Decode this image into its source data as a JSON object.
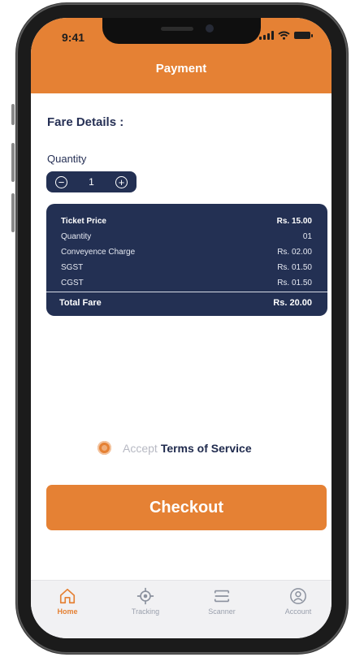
{
  "status_bar": {
    "time": "9:41"
  },
  "header": {
    "title": "Payment"
  },
  "fare_details": {
    "title": "Fare Details :",
    "quantity_label": "Quantity",
    "stepper": {
      "minus": "−",
      "value": "1",
      "plus": "+"
    }
  },
  "fare_card": {
    "rows": [
      {
        "label": "Ticket Price",
        "value": "Rs. 15.00"
      },
      {
        "label": "Quantity",
        "value": "01"
      },
      {
        "label": "Conveyence Charge",
        "value": "Rs. 02.00"
      },
      {
        "label": "SGST",
        "value": "Rs. 01.50"
      },
      {
        "label": "CGST",
        "value": "Rs. 01.50"
      }
    ],
    "total": {
      "label": "Total Fare",
      "value": "Rs. 20.00"
    }
  },
  "terms": {
    "accept": "Accept",
    "link": "Terms of Service"
  },
  "checkout": {
    "label": "Checkout"
  },
  "nav": {
    "items": [
      {
        "label": "Home",
        "icon": "home-icon"
      },
      {
        "label": "Tracking",
        "icon": "crosshair-icon"
      },
      {
        "label": "Scanner",
        "icon": "scanner-icon"
      },
      {
        "label": "Account",
        "icon": "user-circle-icon"
      }
    ]
  },
  "colors": {
    "accent": "#e58134",
    "navy": "#233053",
    "muted": "#9aa0ad"
  }
}
